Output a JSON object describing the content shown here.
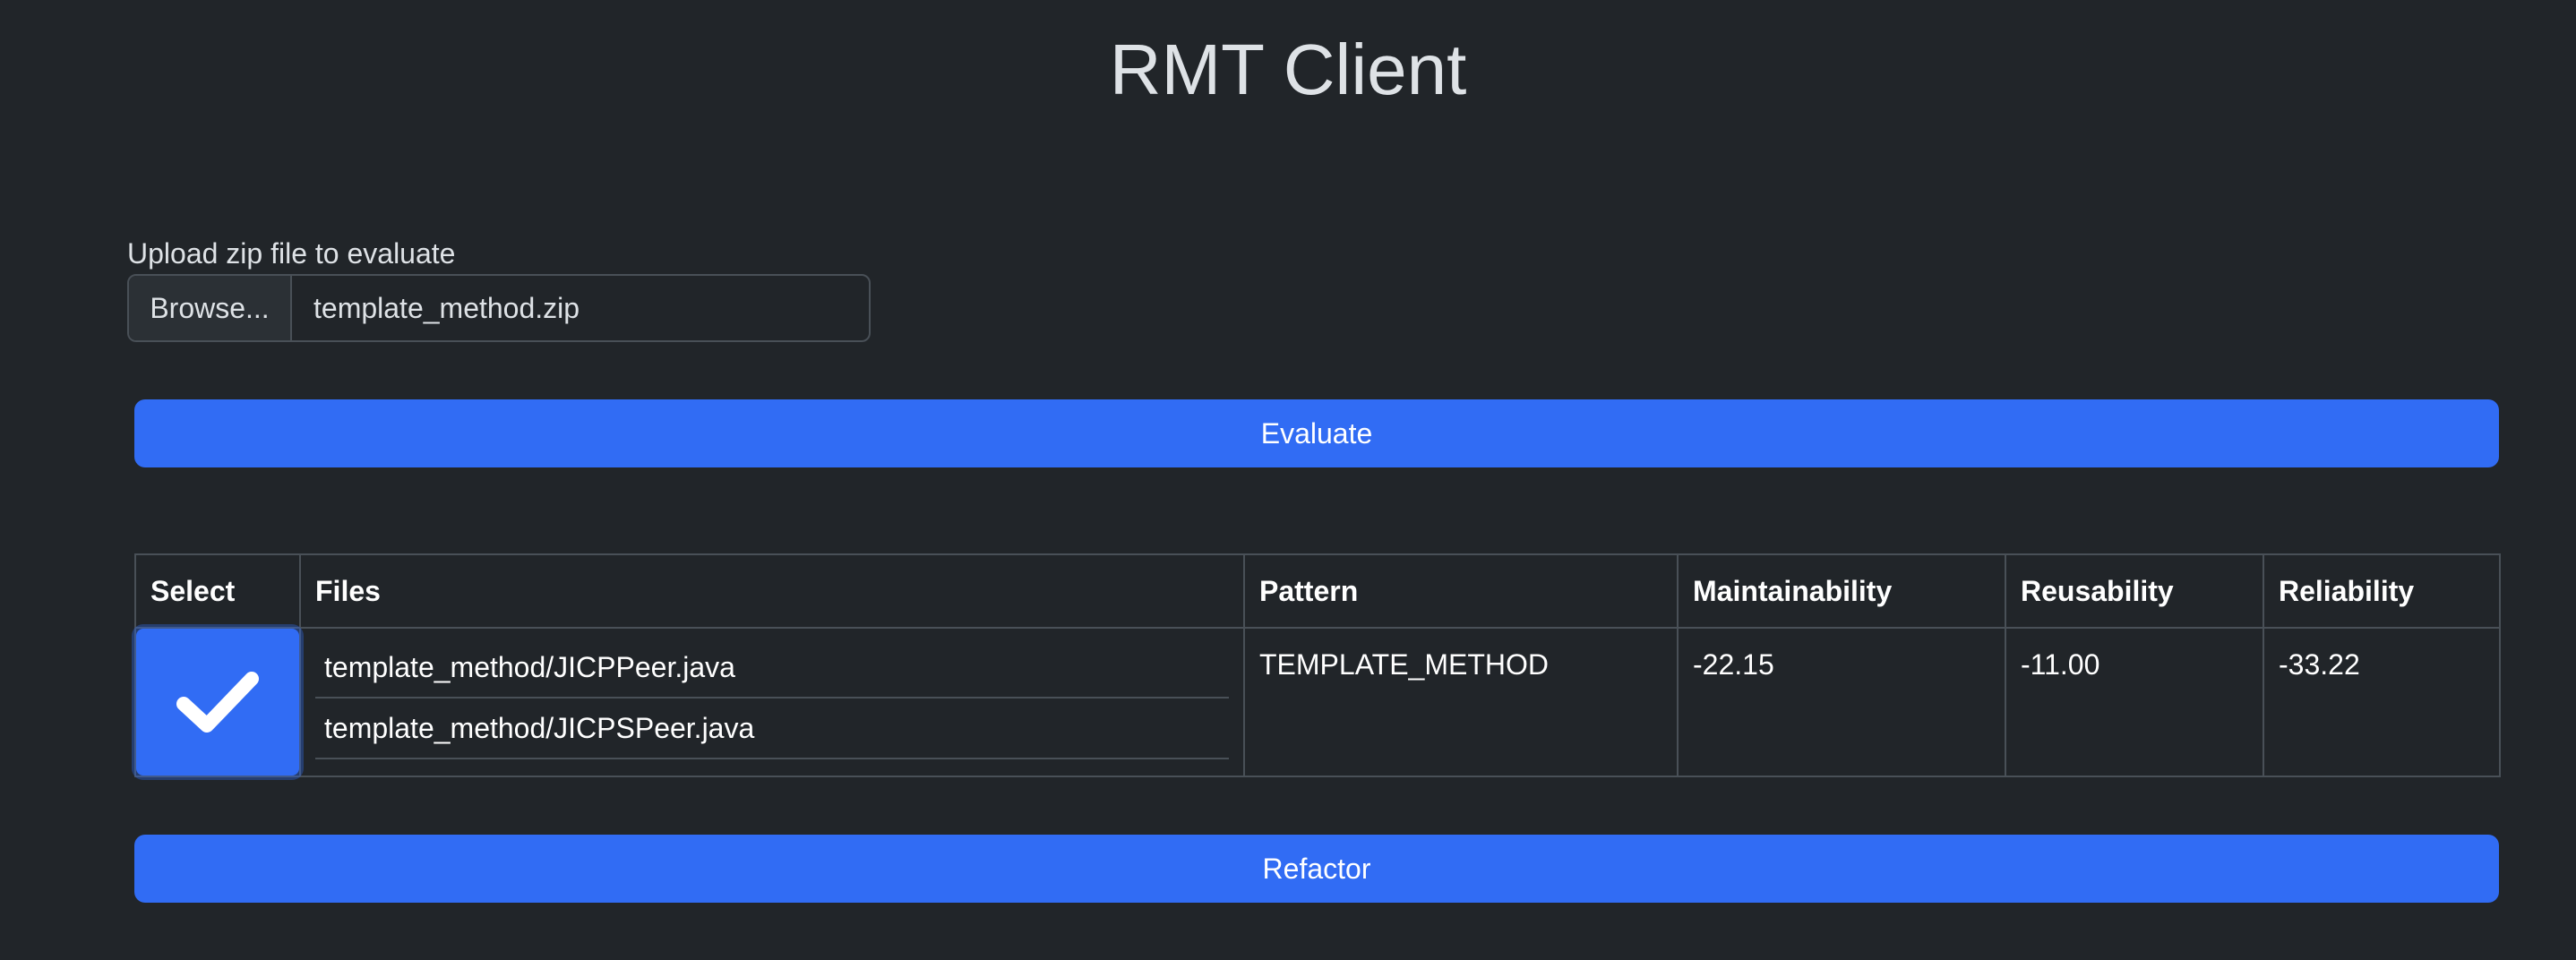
{
  "page": {
    "title": "RMT Client"
  },
  "upload": {
    "label": "Upload zip file to evaluate",
    "browse_label": "Browse...",
    "file_name": "template_method.zip"
  },
  "actions": {
    "evaluate_label": "Evaluate",
    "refactor_label": "Refactor"
  },
  "table": {
    "headers": [
      "Select",
      "Files",
      "Pattern",
      "Maintainability",
      "Reusability",
      "Reliability"
    ],
    "rows": [
      {
        "selected": true,
        "files": [
          "template_method/JICPPeer.java",
          "template_method/JICPSPeer.java"
        ],
        "pattern": "TEMPLATE_METHOD",
        "maintainability": "-22.15",
        "reusability": "-11.00",
        "reliability": "-33.22"
      }
    ]
  },
  "colors": {
    "background": "#212529",
    "accent": "#316cf4",
    "border": "#495057"
  },
  "icons": {
    "checkbox": "check-icon"
  }
}
